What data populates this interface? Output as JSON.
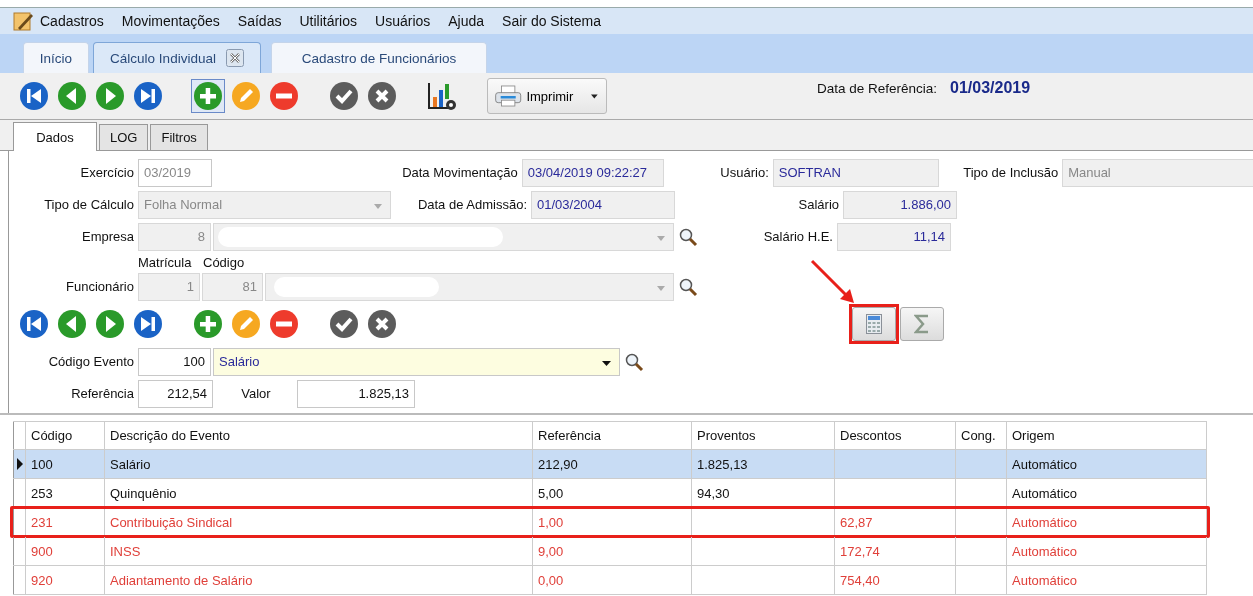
{
  "menu": [
    {
      "label": "Cadastros"
    },
    {
      "label": "Movimentações"
    },
    {
      "label": "Saídas"
    },
    {
      "label": "Utilitários"
    },
    {
      "label": "Usuários"
    },
    {
      "label": "Ajuda"
    },
    {
      "label": "Sair do Sistema"
    }
  ],
  "tabs": [
    {
      "label": "Início",
      "selected": false,
      "closable": false
    },
    {
      "label": "Cálculo Individual",
      "selected": true,
      "closable": true
    },
    {
      "label": "Cadastro de Funcionários",
      "selected": false,
      "closable": false
    }
  ],
  "toolbar": {
    "buttons": [
      {
        "kind": "first",
        "focused": false
      },
      {
        "kind": "prev",
        "focused": false
      },
      {
        "kind": "next",
        "focused": false
      },
      {
        "kind": "last",
        "focused": false
      },
      {
        "kind": "add",
        "focused": true
      },
      {
        "kind": "edit",
        "focused": false
      },
      {
        "kind": "delete",
        "focused": false
      },
      {
        "kind": "confirm",
        "focused": false
      },
      {
        "kind": "cancel",
        "focused": false
      },
      {
        "kind": "chart",
        "focused": false
      }
    ],
    "print": {
      "label": "Imprimir"
    },
    "reference": {
      "label": "Data de Referência:",
      "value": "01/03/2019"
    }
  },
  "subtabs": [
    {
      "label": "Dados",
      "selected": true
    },
    {
      "label": "LOG",
      "selected": false
    },
    {
      "label": "Filtros",
      "selected": false
    }
  ],
  "form": {
    "exercicio": {
      "label": "Exercício",
      "value": "03/2019"
    },
    "data_movimentacao": {
      "label": "Data Movimentação",
      "value": "03/04/2019 09:22:27"
    },
    "usuario": {
      "label": "Usuário:",
      "value": "SOFTRAN"
    },
    "tipo_inclusao": {
      "label": "Tipo de Inclusão",
      "value": "Manual"
    },
    "tipo_calculo": {
      "label": "Tipo de Cálculo",
      "value": "Folha Normal"
    },
    "data_admissao": {
      "label": "Data de Admissão:",
      "value": "01/03/2004"
    },
    "salario": {
      "label": "Salário",
      "value": "1.886,00"
    },
    "empresa": {
      "label": "Empresa",
      "code": "8"
    },
    "salario_he": {
      "label": "Salário H.E.",
      "value": "11,14"
    },
    "funcionario": {
      "label": "Funcionário",
      "matricula_header": "Matrícula",
      "codigo_header": "Código",
      "matricula": "1",
      "codigo": "81"
    },
    "event_buttons": [
      {
        "kind": "first"
      },
      {
        "kind": "prev"
      },
      {
        "kind": "next"
      },
      {
        "kind": "last"
      },
      {
        "kind": "add"
      },
      {
        "kind": "edit"
      },
      {
        "kind": "delete"
      },
      {
        "kind": "confirm"
      },
      {
        "kind": "cancel"
      }
    ],
    "calc_buttons": [
      {
        "kind": "calculator",
        "highlighted": true
      },
      {
        "kind": "sum",
        "highlighted": false
      }
    ],
    "codigo_evento": {
      "label": "Código Evento",
      "code": "100",
      "value": "Salário"
    },
    "referencia": {
      "label": "Referência",
      "value": "212,54"
    },
    "valor": {
      "label": "Valor",
      "value": "1.825,13"
    }
  },
  "table": {
    "columns": [
      "Código",
      "Descrição do Evento",
      "Referência",
      "Proventos",
      "Descontos",
      "Cong.",
      "Origem"
    ],
    "rows": [
      {
        "cells": [
          "100",
          "Salário",
          "212,90",
          "1.825,13",
          null,
          null,
          "Automático"
        ],
        "selected": true,
        "kind": "provento",
        "highlighted": false
      },
      {
        "cells": [
          "253",
          "Quinquênio",
          "5,00",
          "94,30",
          null,
          null,
          "Automático"
        ],
        "selected": false,
        "kind": "provento",
        "highlighted": false
      },
      {
        "cells": [
          "231",
          "Contribuição Sindical",
          "1,00",
          null,
          "62,87",
          null,
          "Automático"
        ],
        "selected": false,
        "kind": "desconto",
        "highlighted": true
      },
      {
        "cells": [
          "900",
          "INSS",
          "9,00",
          null,
          "172,74",
          null,
          "Automático"
        ],
        "selected": false,
        "kind": "desconto",
        "highlighted": false
      },
      {
        "cells": [
          "920",
          "Adiantamento de Salário",
          "0,00",
          null,
          "754,40",
          null,
          "Automático"
        ],
        "selected": false,
        "kind": "desconto",
        "highlighted": false
      }
    ]
  }
}
